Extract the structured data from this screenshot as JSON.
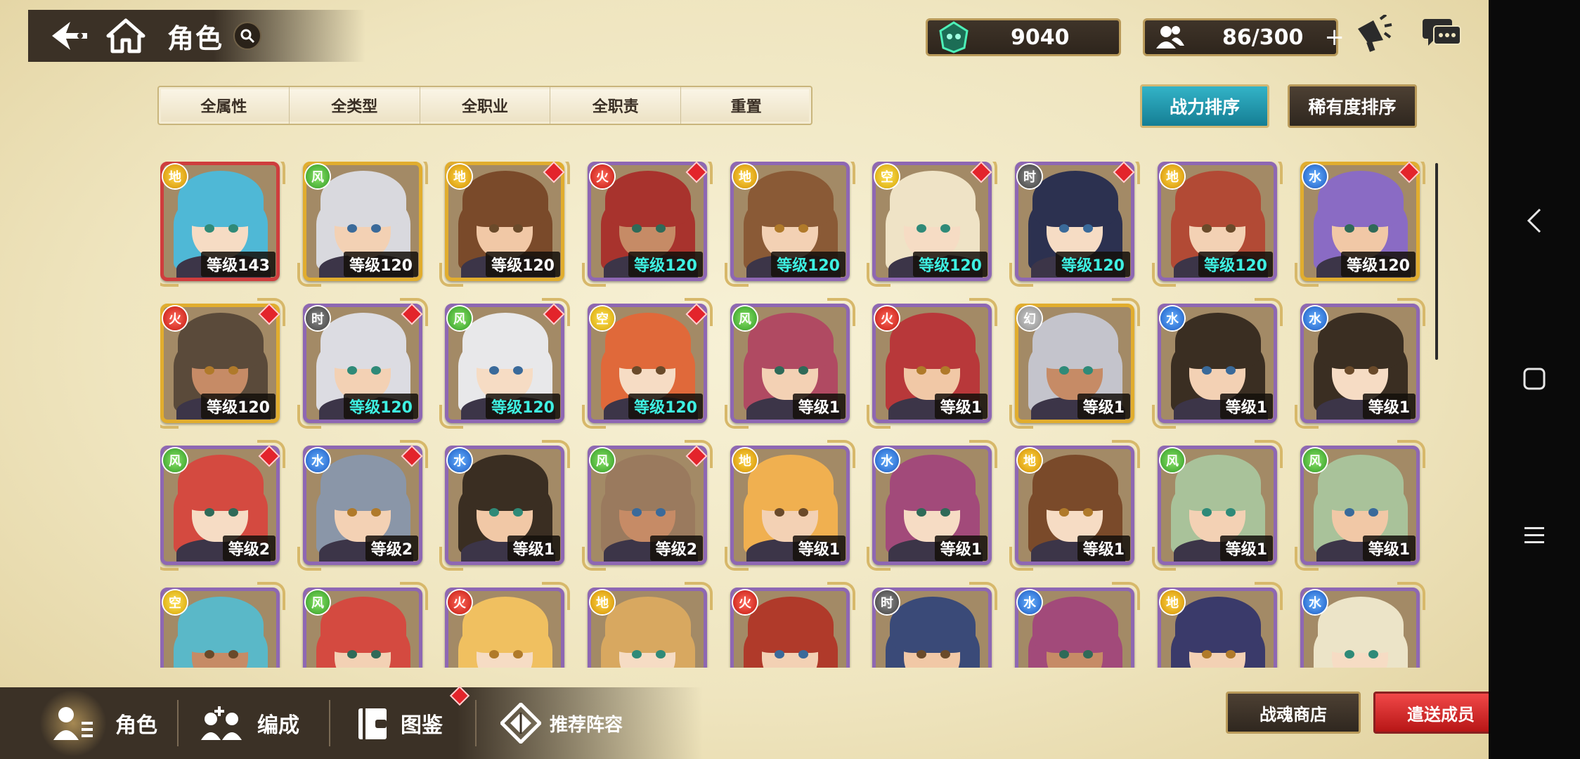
{
  "header": {
    "title": "角色",
    "gems": "9040",
    "members": "86/300"
  },
  "filters": [
    "全属性",
    "全类型",
    "全职业",
    "全职责",
    "重置"
  ],
  "sort": {
    "power": "战力排序",
    "rarity": "稀有度排序"
  },
  "characters": [
    {
      "element": "地",
      "level": "等级143"
    },
    {
      "element": "风",
      "level": "等级120"
    },
    {
      "element": "地",
      "level": "等级120"
    },
    {
      "element": "火",
      "level": "等级120"
    },
    {
      "element": "地",
      "level": "等级120"
    },
    {
      "element": "空",
      "level": "等级120"
    },
    {
      "element": "时",
      "level": "等级120"
    },
    {
      "element": "地",
      "level": "等级120"
    },
    {
      "element": "水",
      "level": "等级120"
    },
    {
      "element": "火",
      "level": "等级120"
    },
    {
      "element": "时",
      "level": "等级120"
    },
    {
      "element": "风",
      "level": "等级120"
    },
    {
      "element": "空",
      "level": "等级120"
    },
    {
      "element": "风",
      "level": "等级1"
    },
    {
      "element": "火",
      "level": "等级1"
    },
    {
      "element": "幻",
      "level": "等级1"
    },
    {
      "element": "水",
      "level": "等级1"
    },
    {
      "element": "水",
      "level": "等级1"
    },
    {
      "element": "风",
      "level": "等级2"
    },
    {
      "element": "水",
      "level": "等级2"
    },
    {
      "element": "水",
      "level": "等级1"
    },
    {
      "element": "风",
      "level": "等级2"
    },
    {
      "element": "地",
      "level": "等级1"
    },
    {
      "element": "水",
      "level": "等级1"
    },
    {
      "element": "地",
      "level": "等级1"
    },
    {
      "element": "风",
      "level": "等级1"
    },
    {
      "element": "风",
      "level": "等级1"
    },
    {
      "element": "空",
      "level": ""
    },
    {
      "element": "风",
      "level": ""
    },
    {
      "element": "火",
      "level": ""
    },
    {
      "element": "地",
      "level": ""
    },
    {
      "element": "火",
      "level": ""
    },
    {
      "element": "时",
      "level": ""
    },
    {
      "element": "水",
      "level": ""
    },
    {
      "element": "地",
      "level": ""
    },
    {
      "element": "水",
      "level": ""
    }
  ],
  "tabs": {
    "role": "角色",
    "formation": "编成",
    "codex": "图鉴",
    "recommend": "推荐阵容"
  },
  "buttons": {
    "shop": "战魂商店",
    "dismiss": "遣送成员"
  },
  "colors": {
    "accent_cyan": "#1f9fb4",
    "danger_red": "#e02a2a",
    "frame_gold": "#e1ad2e",
    "frame_purple": "#8e67b3"
  }
}
